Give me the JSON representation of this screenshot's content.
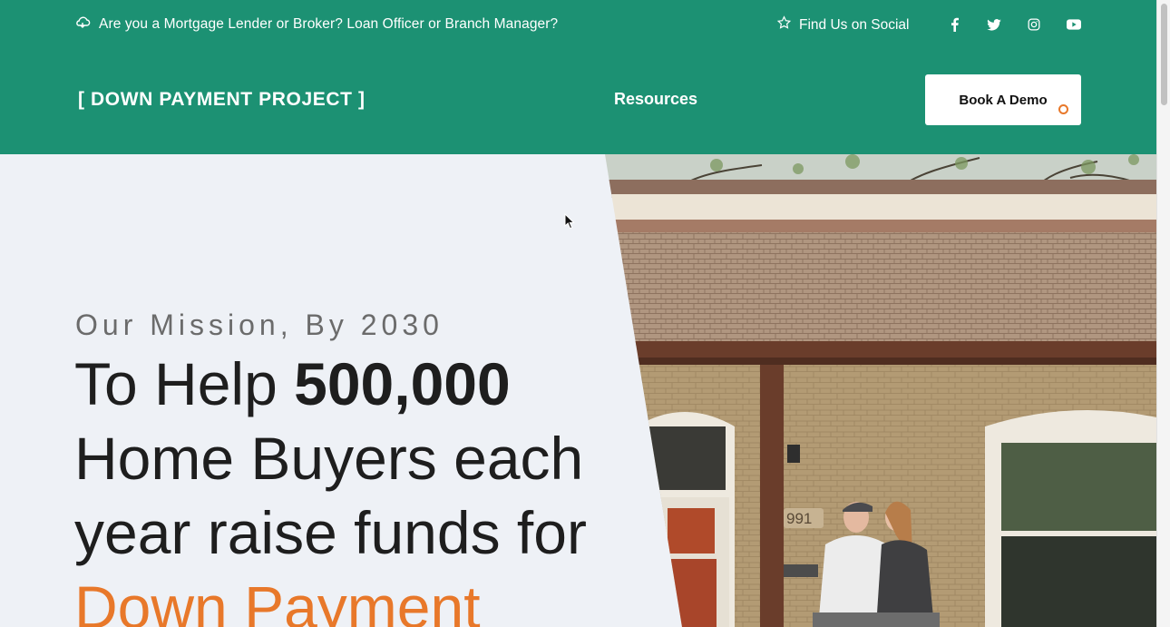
{
  "topbar": {
    "lead_text": "Are you a Mortgage Lender or Broker? Loan Officer or Branch Manager?",
    "social_text": "Find Us on Social",
    "social_icons": [
      "facebook-icon",
      "twitter-icon",
      "instagram-icon",
      "youtube-icon"
    ]
  },
  "header": {
    "logo": "[ DOWN PAYMENT PROJECT ]",
    "nav_resources": "Resources",
    "cta": "Book A Demo"
  },
  "hero": {
    "eyebrow": "Our Mission, By 2030",
    "headline_part1": "To Help ",
    "headline_bold": "500,000",
    "headline_part2": " Home Buyers each year raise funds for ",
    "headline_accent": "Down Payment"
  },
  "colors": {
    "brand_green": "#1c9173",
    "accent_orange": "#e8782a",
    "hero_bg": "#eef1f6"
  }
}
